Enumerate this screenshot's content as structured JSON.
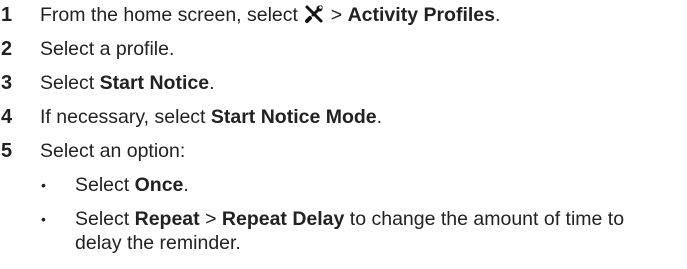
{
  "steps": [
    {
      "num": "1",
      "pre": "From the home screen, select ",
      "icon": "wrench-screwdriver-icon",
      "sep": " > ",
      "bold": "Activity Profiles",
      "post": "."
    },
    {
      "num": "2",
      "text": "Select a profile."
    },
    {
      "num": "3",
      "pre": "Select ",
      "bold": "Start Notice",
      "post": "."
    },
    {
      "num": "4",
      "pre": "If necessary, select ",
      "bold": "Start Notice Mode",
      "post": "."
    },
    {
      "num": "5",
      "text": "Select an option:"
    }
  ],
  "options": [
    {
      "bullet": "•",
      "pre": "Select ",
      "bold": "Once",
      "post": "."
    },
    {
      "bullet": "•",
      "pre": "Select ",
      "bold1": "Repeat",
      "sep": " > ",
      "bold2": "Repeat Delay",
      "post": " to change the amount of time to delay the reminder."
    }
  ]
}
